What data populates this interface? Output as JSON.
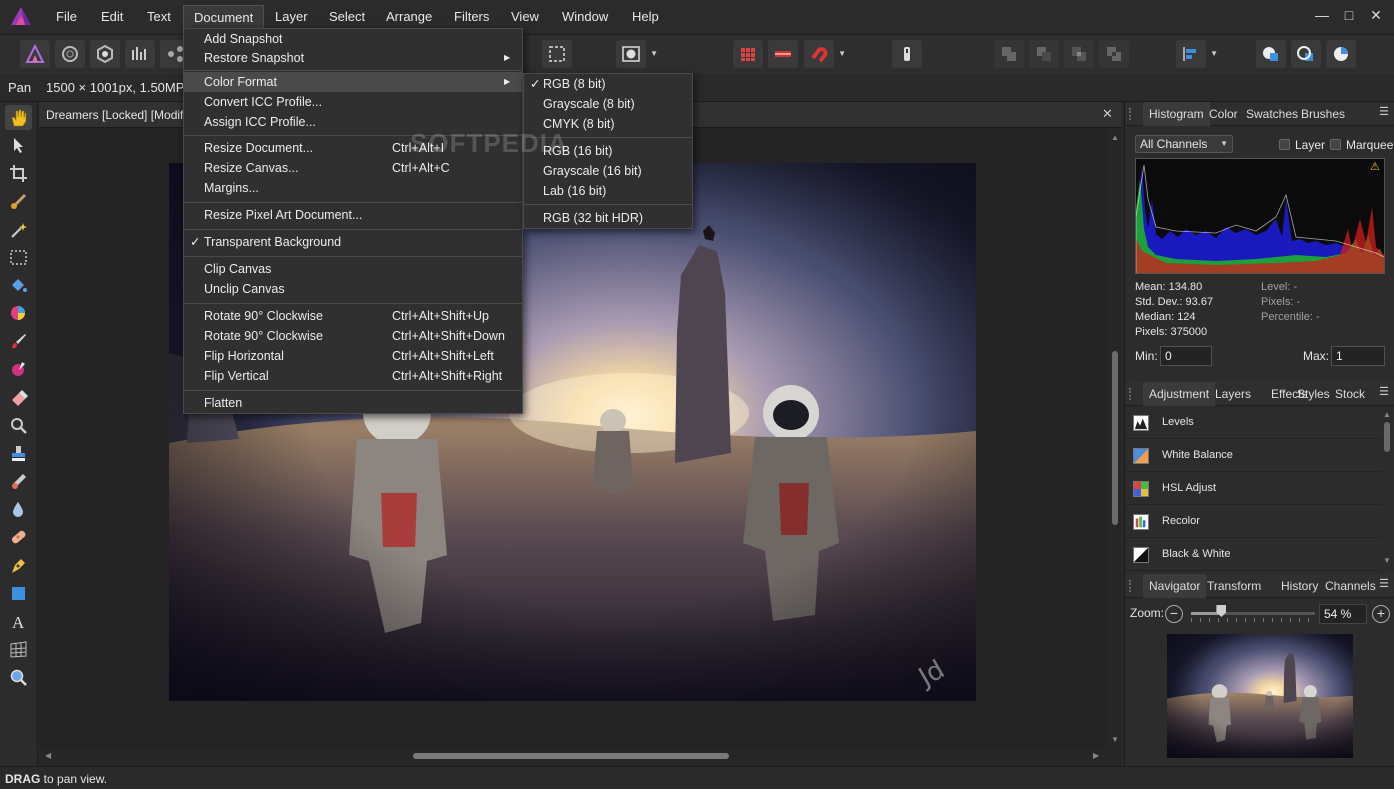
{
  "menubar": {
    "items": [
      "File",
      "Edit",
      "Text",
      "Document",
      "Layer",
      "Select",
      "Arrange",
      "Filters",
      "View",
      "Window",
      "Help"
    ],
    "window_controls": {
      "minimize": "—",
      "maximize": "□",
      "close": "✕"
    }
  },
  "context_bar": {
    "tool_name": "Pan",
    "doc_info": "1500 × 1001px, 1.50MP, R"
  },
  "document": {
    "tab_title": "Dreamers [Locked] [Modified",
    "close": "✕"
  },
  "document_menu": {
    "items": [
      {
        "label": "Add Snapshot"
      },
      {
        "label": "Restore Snapshot",
        "submenu": true
      },
      {
        "label": "Color Format",
        "submenu": true,
        "highlighted": true
      },
      {
        "label": "Convert ICC Profile..."
      },
      {
        "label": "Assign ICC Profile..."
      },
      {
        "label": "Resize Document...",
        "shortcut": "Ctrl+Alt+I"
      },
      {
        "label": "Resize Canvas...",
        "shortcut": "Ctrl+Alt+C"
      },
      {
        "label": "Margins..."
      },
      {
        "label": "Resize Pixel Art Document..."
      },
      {
        "label": "Transparent Background",
        "checked": true
      },
      {
        "label": "Clip Canvas"
      },
      {
        "label": "Unclip Canvas"
      },
      {
        "label": "Rotate 90° Clockwise",
        "shortcut": "Ctrl+Alt+Shift+Up"
      },
      {
        "label": "Rotate 90° Clockwise",
        "shortcut": "Ctrl+Alt+Shift+Down"
      },
      {
        "label": "Flip Horizontal",
        "shortcut": "Ctrl+Alt+Shift+Left"
      },
      {
        "label": "Flip Vertical",
        "shortcut": "Ctrl+Alt+Shift+Right"
      },
      {
        "label": "Flatten"
      }
    ]
  },
  "color_format_submenu": {
    "items": [
      {
        "label": "RGB (8 bit)",
        "checked": true
      },
      {
        "label": "Grayscale (8 bit)"
      },
      {
        "label": "CMYK (8 bit)"
      },
      {
        "label": "RGB (16 bit)"
      },
      {
        "label": "Grayscale (16 bit)"
      },
      {
        "label": "Lab (16 bit)"
      },
      {
        "label": "RGB (32 bit HDR)"
      }
    ]
  },
  "watermark": "SOFTPEDIA",
  "histogram_panel": {
    "tabs": [
      "Histogram",
      "Color",
      "Swatches",
      "Brushes"
    ],
    "channel_select": "All Channels",
    "layer_label": "Layer",
    "marquee_label": "Marquee",
    "warning_icon": "⚠",
    "stats": {
      "mean": "Mean: 134.80",
      "std_dev": "Std. Dev.: 93.67",
      "median": "Median: 124",
      "pixels": "Pixels: 375000",
      "level": "Level: -",
      "pixels_right": "Pixels: -",
      "percentile": "Percentile: -"
    },
    "min_label": "Min:",
    "min_value": "0",
    "max_label": "Max:",
    "max_value": "1"
  },
  "adjustment_panel": {
    "tabs": [
      "Adjustment",
      "Layers",
      "Effects",
      "Styles",
      "Stock"
    ],
    "items": [
      "Levels",
      "White Balance",
      "HSL Adjust",
      "Recolor",
      "Black & White"
    ]
  },
  "navigator_panel": {
    "tabs": [
      "Navigator",
      "Transform",
      "History",
      "Channels"
    ],
    "zoom_label": "Zoom:",
    "zoom_value": "54 %",
    "zoom_level": 54,
    "zoom_out": "−",
    "zoom_in": "+"
  },
  "status": {
    "bold": "DRAG",
    "text": " to pan view."
  },
  "colors": {
    "accent": "#2f7bd6",
    "menu_bg": "#303030",
    "highlight": "#4a4a4a"
  }
}
